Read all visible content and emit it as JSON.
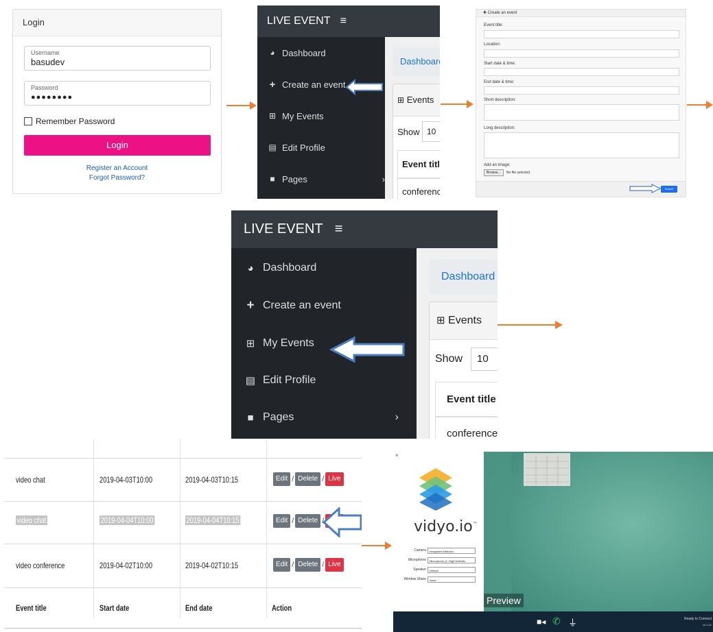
{
  "colors": {
    "login_button": "#ed1186",
    "sidebar_bg": "#212529",
    "topbar_bg": "#343a40",
    "arrow_orange": "#ed7d31",
    "arrow_blue": "#4a7ec0",
    "live_btn": "#dc3545"
  },
  "login": {
    "title": "Login",
    "username_label": "Username",
    "username_value": "basudev",
    "password_label": "Password",
    "password_value": "●●●●●●●●",
    "remember_label": "Remember Password",
    "login_button": "Login",
    "register_link": "Register an Account",
    "forgot_link": "Forgot Password?"
  },
  "menu": {
    "brand": "LIVE EVENT",
    "hamburger_icon": "hamburger-icon",
    "items": [
      {
        "label": "Dashboard",
        "icon": "dashboard-icon"
      },
      {
        "label": "Create an event",
        "icon": "plus-icon"
      },
      {
        "label": "My Events",
        "icon": "table-icon"
      },
      {
        "label": "Edit Profile",
        "icon": "id-card-icon"
      },
      {
        "label": "Pages",
        "icon": "folder-icon"
      }
    ],
    "pages_chevron": "›",
    "breadcrumb": "Dashboard",
    "card_title": "Events",
    "show_label": "Show",
    "show_value": "10",
    "table_header": "Event title",
    "table_cell": "conference"
  },
  "form": {
    "header": "Create an event",
    "labels": {
      "title": "Event title:",
      "location": "Location:",
      "start": "Start date & time:",
      "end": "End date & time:",
      "short": "Short description:",
      "long": "Long description:",
      "image": "Add an image:"
    },
    "browse_button": "Browse...",
    "no_file": "No file selected.",
    "submit": "Submit"
  },
  "events_table": {
    "rows": [
      {
        "title": "video chat",
        "start": "2019-04-03T10:00",
        "end": "2019-04-03T10:15",
        "highlighted": false
      },
      {
        "title": "video chat",
        "start": "2019-04-04T10:00",
        "end": "2019-04-04T10:15",
        "highlighted": true
      },
      {
        "title": "video conference",
        "start": "2019-04-02T10:00",
        "end": "2019-04-02T10:15",
        "highlighted": false
      }
    ],
    "headers": {
      "title": "Event title",
      "start": "Start date",
      "end": "End date",
      "action": "Action"
    },
    "actions": {
      "edit": "Edit",
      "delete": "Delete",
      "live": "Live",
      "sep": "/"
    }
  },
  "vidyo": {
    "close": "×",
    "brand": "vidyo.io",
    "brand_mark": "™",
    "settings": [
      {
        "label": "Camera",
        "value": "Integrated Webcam"
      },
      {
        "label": "Microphone",
        "value": "Microphone (2- High Definitio"
      },
      {
        "label": "Speaker",
        "value": "Default"
      },
      {
        "label": "Window Share",
        "value": "None"
      }
    ],
    "preview_label": "Preview",
    "status": "Ready to Connect",
    "version": "v4.1.21"
  }
}
